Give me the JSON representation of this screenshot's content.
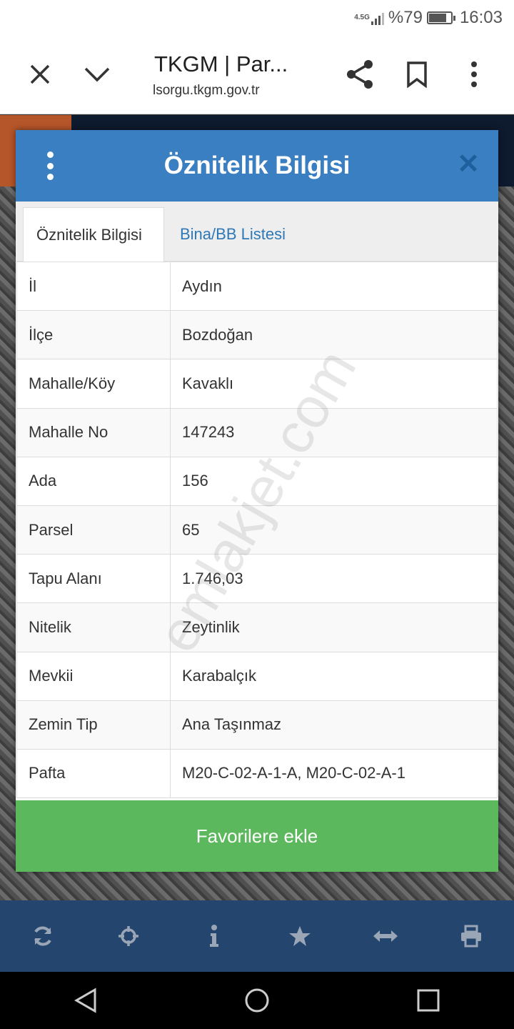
{
  "status_bar": {
    "network": "4.5G",
    "battery_text": "%79",
    "battery_level": 0.79,
    "time": "16:03"
  },
  "browser": {
    "tab_title": "TKGM | Par...",
    "url": "lsorgu.tkgm.gov.tr",
    "icons": [
      "close-icon",
      "chevron-down-icon",
      "share-icon",
      "bookmark-icon",
      "more-vert-icon"
    ]
  },
  "dialog": {
    "title": "Öznitelik Bilgisi",
    "tabs": [
      "Öznitelik Bilgisi",
      "Bina/BB Listesi"
    ],
    "rows": [
      {
        "key": "İl",
        "value": "Aydın"
      },
      {
        "key": "İlçe",
        "value": "Bozdoğan"
      },
      {
        "key": "Mahalle/Köy",
        "value": "Kavaklı"
      },
      {
        "key": "Mahalle No",
        "value": "147243"
      },
      {
        "key": "Ada",
        "value": "156"
      },
      {
        "key": "Parsel",
        "value": "65"
      },
      {
        "key": "Tapu Alanı",
        "value": "1.746,03"
      },
      {
        "key": "Nitelik",
        "value": "Zeytinlik"
      },
      {
        "key": "Mevkii",
        "value": "Karabalçık"
      },
      {
        "key": "Zemin Tip",
        "value": "Ana Taşınmaz"
      },
      {
        "key": "Pafta",
        "value": "M20-C-02-A-1-A, M20-C-02-A-1"
      }
    ],
    "favorite_button": "Favorilere ekle"
  },
  "watermark": "emlakjet.com",
  "toolbar_icons": [
    "refresh-icon",
    "crosshair-icon",
    "info-icon",
    "star-icon",
    "arrows-horizontal-icon",
    "print-icon"
  ],
  "colors": {
    "header_blue": "#3a7fc1",
    "toolbar_blue": "#24466e",
    "button_green": "#5cb85c"
  }
}
